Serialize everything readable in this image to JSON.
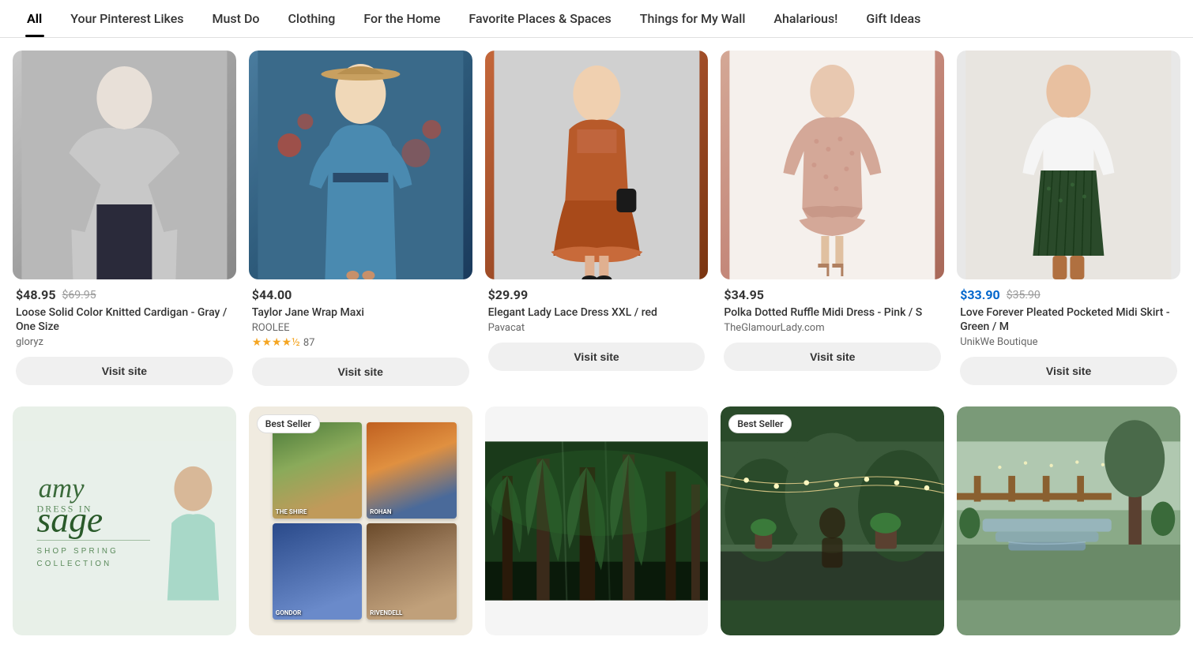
{
  "nav": {
    "items": [
      {
        "id": "all",
        "label": "All",
        "active": true
      },
      {
        "id": "your-pinterest-likes",
        "label": "Your Pinterest Likes",
        "active": false
      },
      {
        "id": "must-do",
        "label": "Must Do",
        "active": false
      },
      {
        "id": "clothing",
        "label": "Clothing",
        "active": false
      },
      {
        "id": "for-the-home",
        "label": "For the Home",
        "active": false
      },
      {
        "id": "favorite-places",
        "label": "Favorite Places & Spaces",
        "active": false
      },
      {
        "id": "things-for-wall",
        "label": "Things for My Wall",
        "active": false
      },
      {
        "id": "ahalarious",
        "label": "Ahalarious!",
        "active": false
      },
      {
        "id": "gift-ideas",
        "label": "Gift Ideas",
        "active": false
      }
    ]
  },
  "products_row1": [
    {
      "id": "cardigan",
      "price_sale": null,
      "price_original": "$69.95",
      "price_regular": null,
      "price_display": "$48.95",
      "is_sale": false,
      "title": "Loose Solid Color Knitted Cardigan - Gray / One Size",
      "brand": "gloryz",
      "rating": null,
      "rating_count": null,
      "visit_label": "Visit site",
      "img_class": "img-cardigan"
    },
    {
      "id": "wrap-maxi",
      "price_sale": null,
      "price_original": null,
      "price_regular": "$44.00",
      "price_display": "$44.00",
      "is_sale": false,
      "title": "Taylor Jane Wrap Maxi",
      "brand": "ROOLEE",
      "rating": "4.5",
      "rating_count": "87",
      "visit_label": "Visit site",
      "img_class": "img-wrap-maxi"
    },
    {
      "id": "lace-dress",
      "price_sale": null,
      "price_original": null,
      "price_regular": "$29.99",
      "price_display": "$29.99",
      "is_sale": false,
      "title": "Elegant Lady Lace Dress XXL / red",
      "brand": "Pavacat",
      "rating": null,
      "rating_count": null,
      "visit_label": "Visit site",
      "img_class": "img-lace-dress"
    },
    {
      "id": "polka-midi",
      "price_sale": null,
      "price_original": null,
      "price_regular": "$34.95",
      "price_display": "$34.95",
      "is_sale": false,
      "title": "Polka Dotted Ruffle Midi Dress - Pink / S",
      "brand": "TheGlamourLady.com",
      "rating": null,
      "rating_count": null,
      "visit_label": "Visit site",
      "img_class": "img-polka-midi"
    },
    {
      "id": "pleated-skirt",
      "price_sale": "$33.90",
      "price_original": "$35.90",
      "price_regular": null,
      "price_display": "$33.90",
      "is_sale": true,
      "title": "Love Forever Pleated Pocketed Midi Skirt - Green / M",
      "brand": "UnikWe Boutique",
      "rating": null,
      "rating_count": null,
      "visit_label": "Visit site",
      "img_class": "img-pleated-skirt"
    }
  ],
  "products_row2": [
    {
      "id": "sage",
      "badge": null,
      "title": "Amy in Sage - Shop Spring Collection",
      "img_class": "img-sage",
      "img_type": "text-overlay"
    },
    {
      "id": "shire-prints",
      "badge": "Best Seller",
      "title": "The Shire / Rohan Art Prints",
      "img_class": "img-shire",
      "img_type": "art-grid"
    },
    {
      "id": "forest",
      "badge": null,
      "title": "Forest Trees Nature Photography",
      "img_class": "img-forest",
      "img_type": "plain"
    },
    {
      "id": "porch",
      "badge": "Best Seller",
      "title": "Porch Backyard Garden",
      "img_class": "img-porch",
      "img_type": "plain"
    },
    {
      "id": "garden",
      "badge": null,
      "title": "Garden Water Feature",
      "img_class": "img-garden",
      "img_type": "plain"
    }
  ],
  "labels": {
    "visit_site": "Visit site",
    "best_seller": "Best Seller",
    "price_48": "$48.95",
    "price_orig_69": "$69.95",
    "price_44": "$44.00",
    "price_29": "$29.99",
    "price_34": "$34.95",
    "price_33": "$33.90",
    "price_orig_35": "$35.90"
  }
}
